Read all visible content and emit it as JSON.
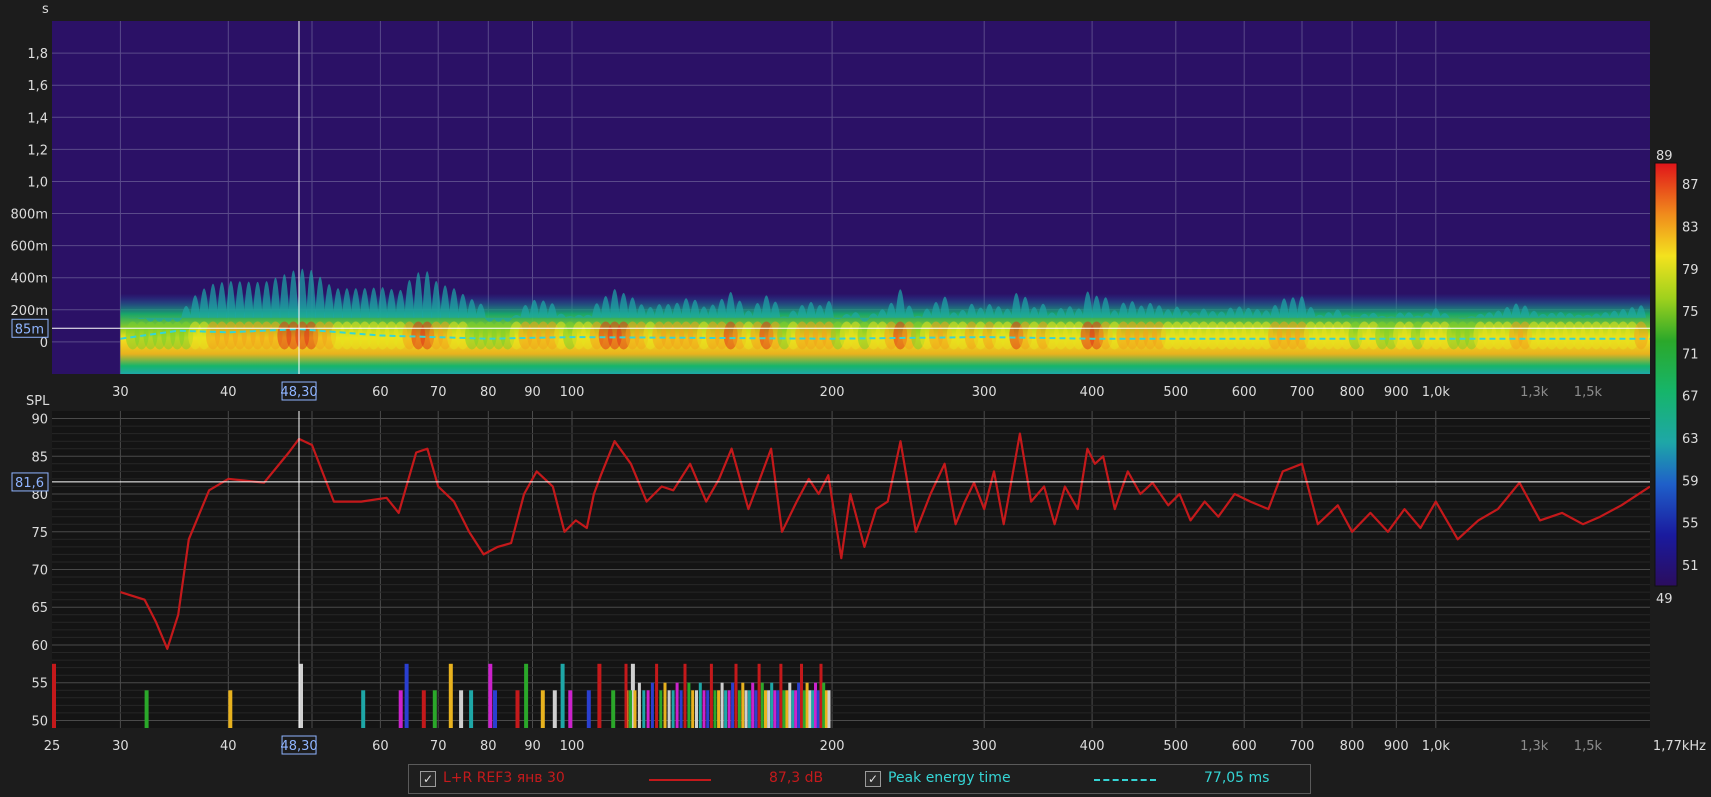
{
  "colors": {
    "background": "#1c1c1c",
    "waterfall_background": "#2b1166",
    "spl_line": "#c4191b",
    "peak_line": "#35d5d5",
    "grid": "#4a4a4a",
    "cursor": "#ffffff",
    "cursor_label": "#8fb4ff"
  },
  "top_panel": {
    "unit_label": "s",
    "y_ticks": [
      "1,8",
      "1,6",
      "1,4",
      "1,2",
      "1,0",
      "800m",
      "600m",
      "400m",
      "200m",
      "0"
    ],
    "cursor_value": "85m"
  },
  "bottom_panel": {
    "unit_label": "SPL",
    "y_ticks": [
      "90",
      "85",
      "80",
      "75",
      "70",
      "65",
      "60",
      "55",
      "50"
    ],
    "cursor_value": "81,6"
  },
  "x_axis": {
    "top_ticks": [
      "30",
      "40",
      "60",
      "70",
      "80",
      "90",
      "100",
      "200",
      "300",
      "400",
      "500",
      "600",
      "700",
      "800",
      "900",
      "1,0k",
      "1,3k",
      "1,5k"
    ],
    "bottom_ticks": [
      "25",
      "30",
      "40",
      "60",
      "70",
      "80",
      "90",
      "100",
      "200",
      "300",
      "400",
      "500",
      "600",
      "700",
      "800",
      "900",
      "1,0k",
      "1,3k",
      "1,5k",
      "1,77kHz"
    ],
    "cursor_value": "48,30"
  },
  "colorbar": {
    "max_label": "89",
    "min_label": "49",
    "tick_labels": [
      "87",
      "83",
      "79",
      "75",
      "71",
      "67",
      "63",
      "59",
      "55",
      "51"
    ]
  },
  "legend": {
    "series1_label": "L+R REF3 янв 30",
    "series1_value": "87,3 dB",
    "series2_label": "Peak energy time",
    "series2_value": "77,05 ms",
    "check_glyph": "✓"
  },
  "chart_data": [
    {
      "type": "heatmap",
      "title": "",
      "xlabel": "",
      "ylabel": "s",
      "x_scale": "log",
      "xlim": [
        25,
        1770
      ],
      "ylim": [
        -0.2,
        2.0
      ],
      "z_range": [
        49,
        89
      ],
      "grid": true,
      "series": [
        {
          "name": "Peak energy time",
          "x": [
            30,
            35,
            40,
            48.3,
            60,
            80,
            100,
            200,
            300,
            400,
            500,
            600,
            800,
            1000,
            1770
          ],
          "y": [
            0.02,
            0.07,
            0.06,
            0.08,
            0.04,
            0.02,
            0.03,
            0.02,
            0.03,
            0.02,
            0.02,
            0.02,
            0.02,
            0.02,
            0.02
          ]
        }
      ]
    },
    {
      "type": "line",
      "title": "",
      "xlabel": "",
      "ylabel": "SPL",
      "x_scale": "log",
      "xlim": [
        25,
        1770
      ],
      "ylim": [
        49,
        91
      ],
      "grid": true,
      "series": [
        {
          "name": "L+R REF3 янв 30",
          "x": [
            30,
            32,
            33,
            34,
            35,
            36,
            38,
            40,
            44,
            47,
            48.3,
            50,
            53,
            57,
            61,
            63,
            66,
            68,
            70,
            73,
            76,
            79,
            82,
            85,
            88,
            91,
            95,
            98,
            101,
            104,
            106,
            108,
            112,
            117,
            122,
            127,
            131,
            137,
            143,
            148,
            153,
            160,
            165,
            170,
            175,
            182,
            188,
            193,
            198,
            205,
            210,
            218,
            225,
            232,
            240,
            250,
            260,
            270,
            278,
            285,
            292,
            300,
            308,
            316,
            330,
            340,
            352,
            362,
            372,
            385,
            395,
            403,
            412,
            425,
            440,
            455,
            470,
            490,
            505,
            520,
            540,
            560,
            585,
            610,
            640,
            665,
            700,
            730,
            770,
            800,
            840,
            880,
            920,
            960,
            1000,
            1060,
            1120,
            1180,
            1250,
            1320,
            1400,
            1480,
            1550,
            1640,
            1770
          ],
          "y": [
            67,
            66,
            63,
            59.5,
            64,
            74,
            80.5,
            82,
            81.5,
            85.5,
            87.3,
            86.5,
            79,
            79,
            79.5,
            77.5,
            85.5,
            86,
            81,
            79,
            75,
            72,
            73,
            73.5,
            80,
            83,
            81,
            75,
            76.5,
            75.5,
            80,
            82.5,
            87,
            84,
            79,
            81,
            80.5,
            84,
            79,
            82,
            86,
            78,
            82,
            86,
            75,
            79,
            82,
            80,
            82.5,
            71.5,
            80,
            73,
            78,
            79,
            87,
            75,
            80,
            84,
            76,
            79,
            81.5,
            78,
            83,
            76,
            88,
            79,
            81,
            76,
            81,
            78,
            86,
            84,
            85,
            78,
            83,
            80,
            81.5,
            78.5,
            80,
            76.5,
            79,
            77,
            80,
            79,
            78,
            83,
            84,
            76,
            78.5,
            75,
            77.5,
            75,
            78,
            75.5,
            79,
            74,
            76.5,
            78,
            81.5,
            76.5,
            77.5,
            76,
            77,
            78.5,
            81
          ]
        }
      ]
    }
  ]
}
